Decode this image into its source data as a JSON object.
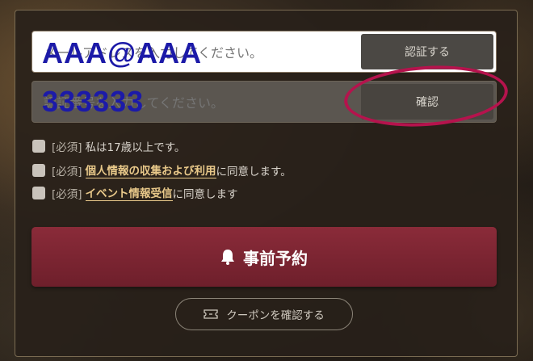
{
  "form": {
    "email": {
      "placeholder": "メールアドレスを入力してください。",
      "typed_overlay": "AAA@AAA",
      "verify_button": "認証する"
    },
    "code": {
      "placeholder": "認証番号を入力してください。",
      "typed_overlay": "333333",
      "confirm_button": "確認"
    }
  },
  "agreements": [
    {
      "required": "[必須]",
      "text": "私は17歳以上です。",
      "link": "",
      "suffix": ""
    },
    {
      "required": "[必須]",
      "text": "",
      "link": "個人情報の収集および利用",
      "suffix": "に同意します。"
    },
    {
      "required": "[必須]",
      "text": "",
      "link": "イベント情報受信",
      "suffix": "に同意します"
    }
  ],
  "reserve_button": {
    "label": "事前予約",
    "icon": "bell-icon"
  },
  "coupon_button": {
    "label": "クーポンを確認する",
    "icon": "ticket-icon"
  },
  "colors": {
    "accent": "#7c2533",
    "annotation": "#b5134d",
    "typed": "#1c1aa8"
  }
}
